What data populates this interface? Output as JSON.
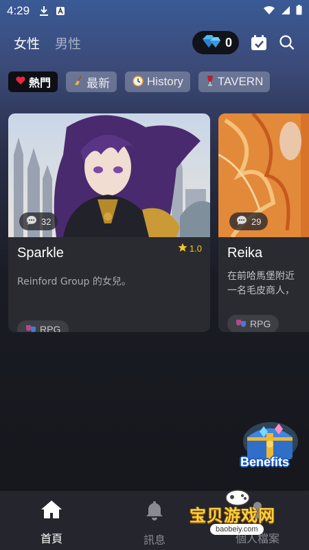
{
  "status_bar": {
    "time": "4:29",
    "icons": [
      "download-icon",
      "app-notification-icon",
      "wifi-icon",
      "signal-icon",
      "battery-icon"
    ]
  },
  "header": {
    "tabs": [
      {
        "label": "女性",
        "active": true
      },
      {
        "label": "男性",
        "active": false
      }
    ],
    "gem_count": "0",
    "icons": [
      "gem-icon",
      "calendar-check-icon",
      "search-icon"
    ]
  },
  "tags": [
    {
      "label": "熱門",
      "icon": "heart-icon",
      "active": true
    },
    {
      "label": "最新",
      "icon": "broom-icon",
      "active": false
    },
    {
      "label": "History",
      "icon": "clock-icon",
      "active": false
    },
    {
      "label": "TAVERN",
      "icon": "wine-glass-icon",
      "active": false
    }
  ],
  "cards": [
    {
      "name": "Sparkle",
      "rating": "1.0",
      "comments": "32",
      "description": "Reinford Group 的女兒。",
      "genre": "RPG"
    },
    {
      "name": "Reika",
      "rating": "",
      "comments": "29",
      "description": "在前哈馬堡附近一名毛皮商人，",
      "genre": "RPG"
    }
  ],
  "benefits": {
    "label": "Benefits"
  },
  "bottom_nav": [
    {
      "label": "首頁",
      "icon": "home-icon",
      "active": true
    },
    {
      "label": "訊息",
      "icon": "bell-icon",
      "active": false
    },
    {
      "label": "個人檔案",
      "icon": "profile-icon",
      "active": false
    }
  ],
  "watermark": {
    "text": "宝贝游戏网",
    "url": "baobeiy.com"
  },
  "colors": {
    "card_bg": "#2a2b30",
    "rating_star": "#f2c431",
    "nav_bg": "#24252d",
    "tag_active_bg": "#0d0f14"
  }
}
